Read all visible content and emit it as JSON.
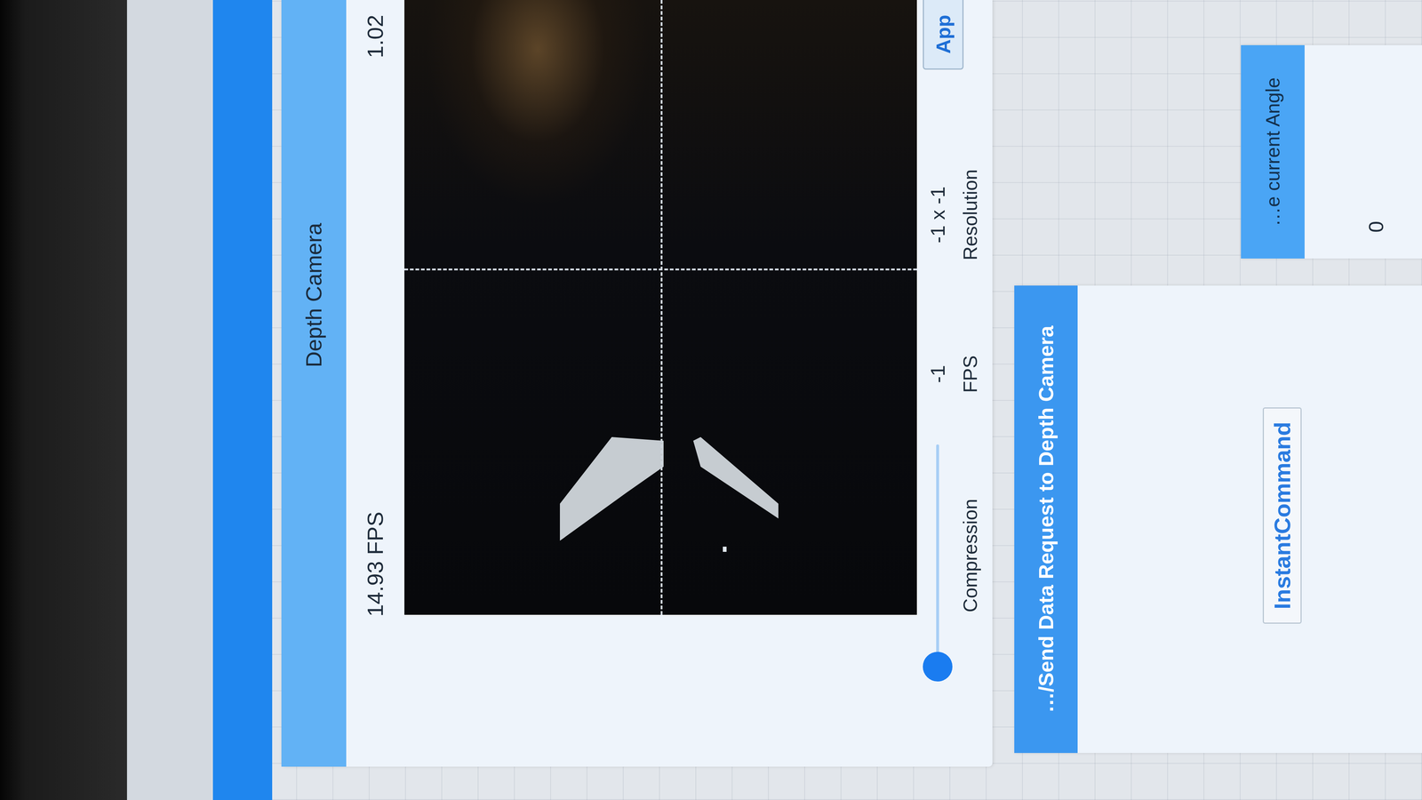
{
  "panels": {
    "depth_camera": {
      "title": "Depth Camera",
      "fps_reading": "14.93 FPS",
      "value": "1.02",
      "compression": {
        "label": "Compression",
        "level": 0
      },
      "fps": {
        "value": "-1",
        "label": "FPS"
      },
      "resolution": {
        "value": "-1 x -1",
        "label": "Resolution"
      },
      "apply_button": "App"
    },
    "send_request": {
      "title": "…/Send Data Request to Depth Camera",
      "button": "InstantCommand"
    },
    "angle": {
      "title": "…e current Angle",
      "value": "0"
    }
  }
}
